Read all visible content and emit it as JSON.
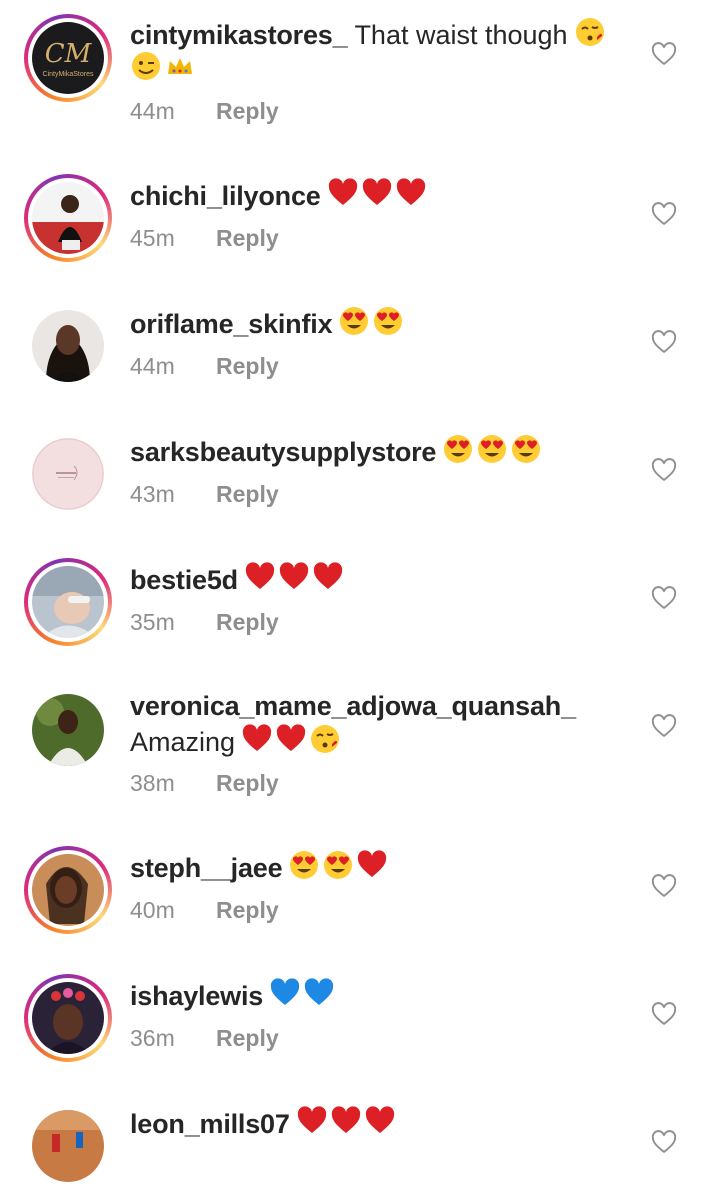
{
  "reply_label": "Reply",
  "comments": [
    {
      "username": "cintymikastores_",
      "text": "That waist though",
      "emojis": [
        "kiss",
        "wink",
        "crown"
      ],
      "time": "44m",
      "story": true,
      "avatar_text": "CintyMikaStores"
    },
    {
      "username": "chichi_lilyonce",
      "text": "",
      "emojis": [
        "heart",
        "heart",
        "heart"
      ],
      "time": "45m",
      "story": true
    },
    {
      "username": "oriflame_skinfix",
      "text": "",
      "emojis": [
        "heart-eyes",
        "heart-eyes"
      ],
      "time": "44m",
      "story": false
    },
    {
      "username": "sarksbeautysupplystore",
      "text": "",
      "emojis": [
        "heart-eyes",
        "heart-eyes",
        "heart-eyes"
      ],
      "time": "43m",
      "story": false
    },
    {
      "username": "bestie5d",
      "text": "",
      "emojis": [
        "heart",
        "heart",
        "heart"
      ],
      "time": "35m",
      "story": true
    },
    {
      "username": "veronica_mame_adjowa_quansah_",
      "text": "Amazing",
      "emojis": [
        "heart",
        "heart",
        "kiss"
      ],
      "time": "38m",
      "story": false
    },
    {
      "username": "steph__jaee",
      "text": "",
      "emojis": [
        "heart-eyes",
        "heart-eyes",
        "heart"
      ],
      "time": "40m",
      "story": true
    },
    {
      "username": "ishaylewis",
      "text": "",
      "emojis": [
        "blue-heart",
        "blue-heart"
      ],
      "time": "36m",
      "story": true
    },
    {
      "username": "leon_mills07",
      "text": "",
      "emojis": [
        "heart",
        "heart",
        "heart"
      ],
      "time": "",
      "story": false
    }
  ],
  "colors": {
    "heart": "#dd1f26",
    "blue_heart": "#1e88e5",
    "emoji_face": "#ffcc33",
    "story_ring": "#dd2a7b"
  }
}
